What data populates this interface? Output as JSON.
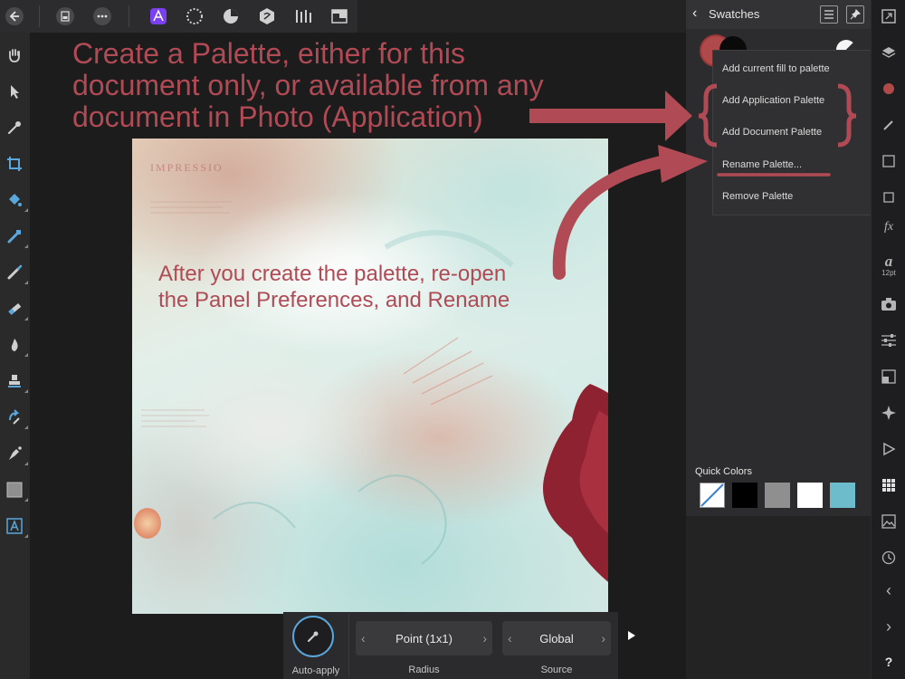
{
  "annotation": {
    "title_line1": "Create a Palette, either for this",
    "title_line2": "document only, or available from any",
    "title_line3": "document in Photo (Application)",
    "body_line1": "After you create the palette, re-open",
    "body_line2": "the Panel Preferences, and Rename",
    "color": "#b04a55"
  },
  "document": {
    "stamp_text": "IMPRESSIO"
  },
  "panel": {
    "title": "Swatches",
    "quick_colors_label": "Quick Colors",
    "quick_colors": [
      "none",
      "#000000",
      "#8f8f8f",
      "#ffffff",
      "#6cbccb"
    ]
  },
  "menu": {
    "items": [
      "Add current fill to palette",
      "Add Application Palette",
      "Add Document Palette",
      "Rename Palette...",
      "Remove Palette"
    ]
  },
  "bottombar": {
    "auto_apply_label": "Auto-apply",
    "radius_value": "Point (1x1)",
    "radius_label": "Radius",
    "source_value": "Global",
    "source_label": "Source"
  },
  "right_toolbar": {
    "font_size_label": "12pt",
    "help_label": "?"
  },
  "icons": [
    "back-icon",
    "document-icon",
    "more-icon",
    "photo-persona-icon",
    "liquify-persona-icon",
    "develop-persona-icon",
    "tone-map-persona-icon",
    "export-persona-icon",
    "hand-tool-icon",
    "move-tool-icon",
    "color-picker-tool-icon",
    "crop-tool-icon",
    "flood-fill-tool-icon",
    "selection-brush-tool-icon",
    "paint-brush-tool-icon",
    "erase-brush-tool-icon",
    "burn-tool-icon",
    "clone-tool-icon",
    "red-eye-tool-icon",
    "pen-tool-icon",
    "rectangle-tool-icon",
    "text-tool-icon"
  ]
}
